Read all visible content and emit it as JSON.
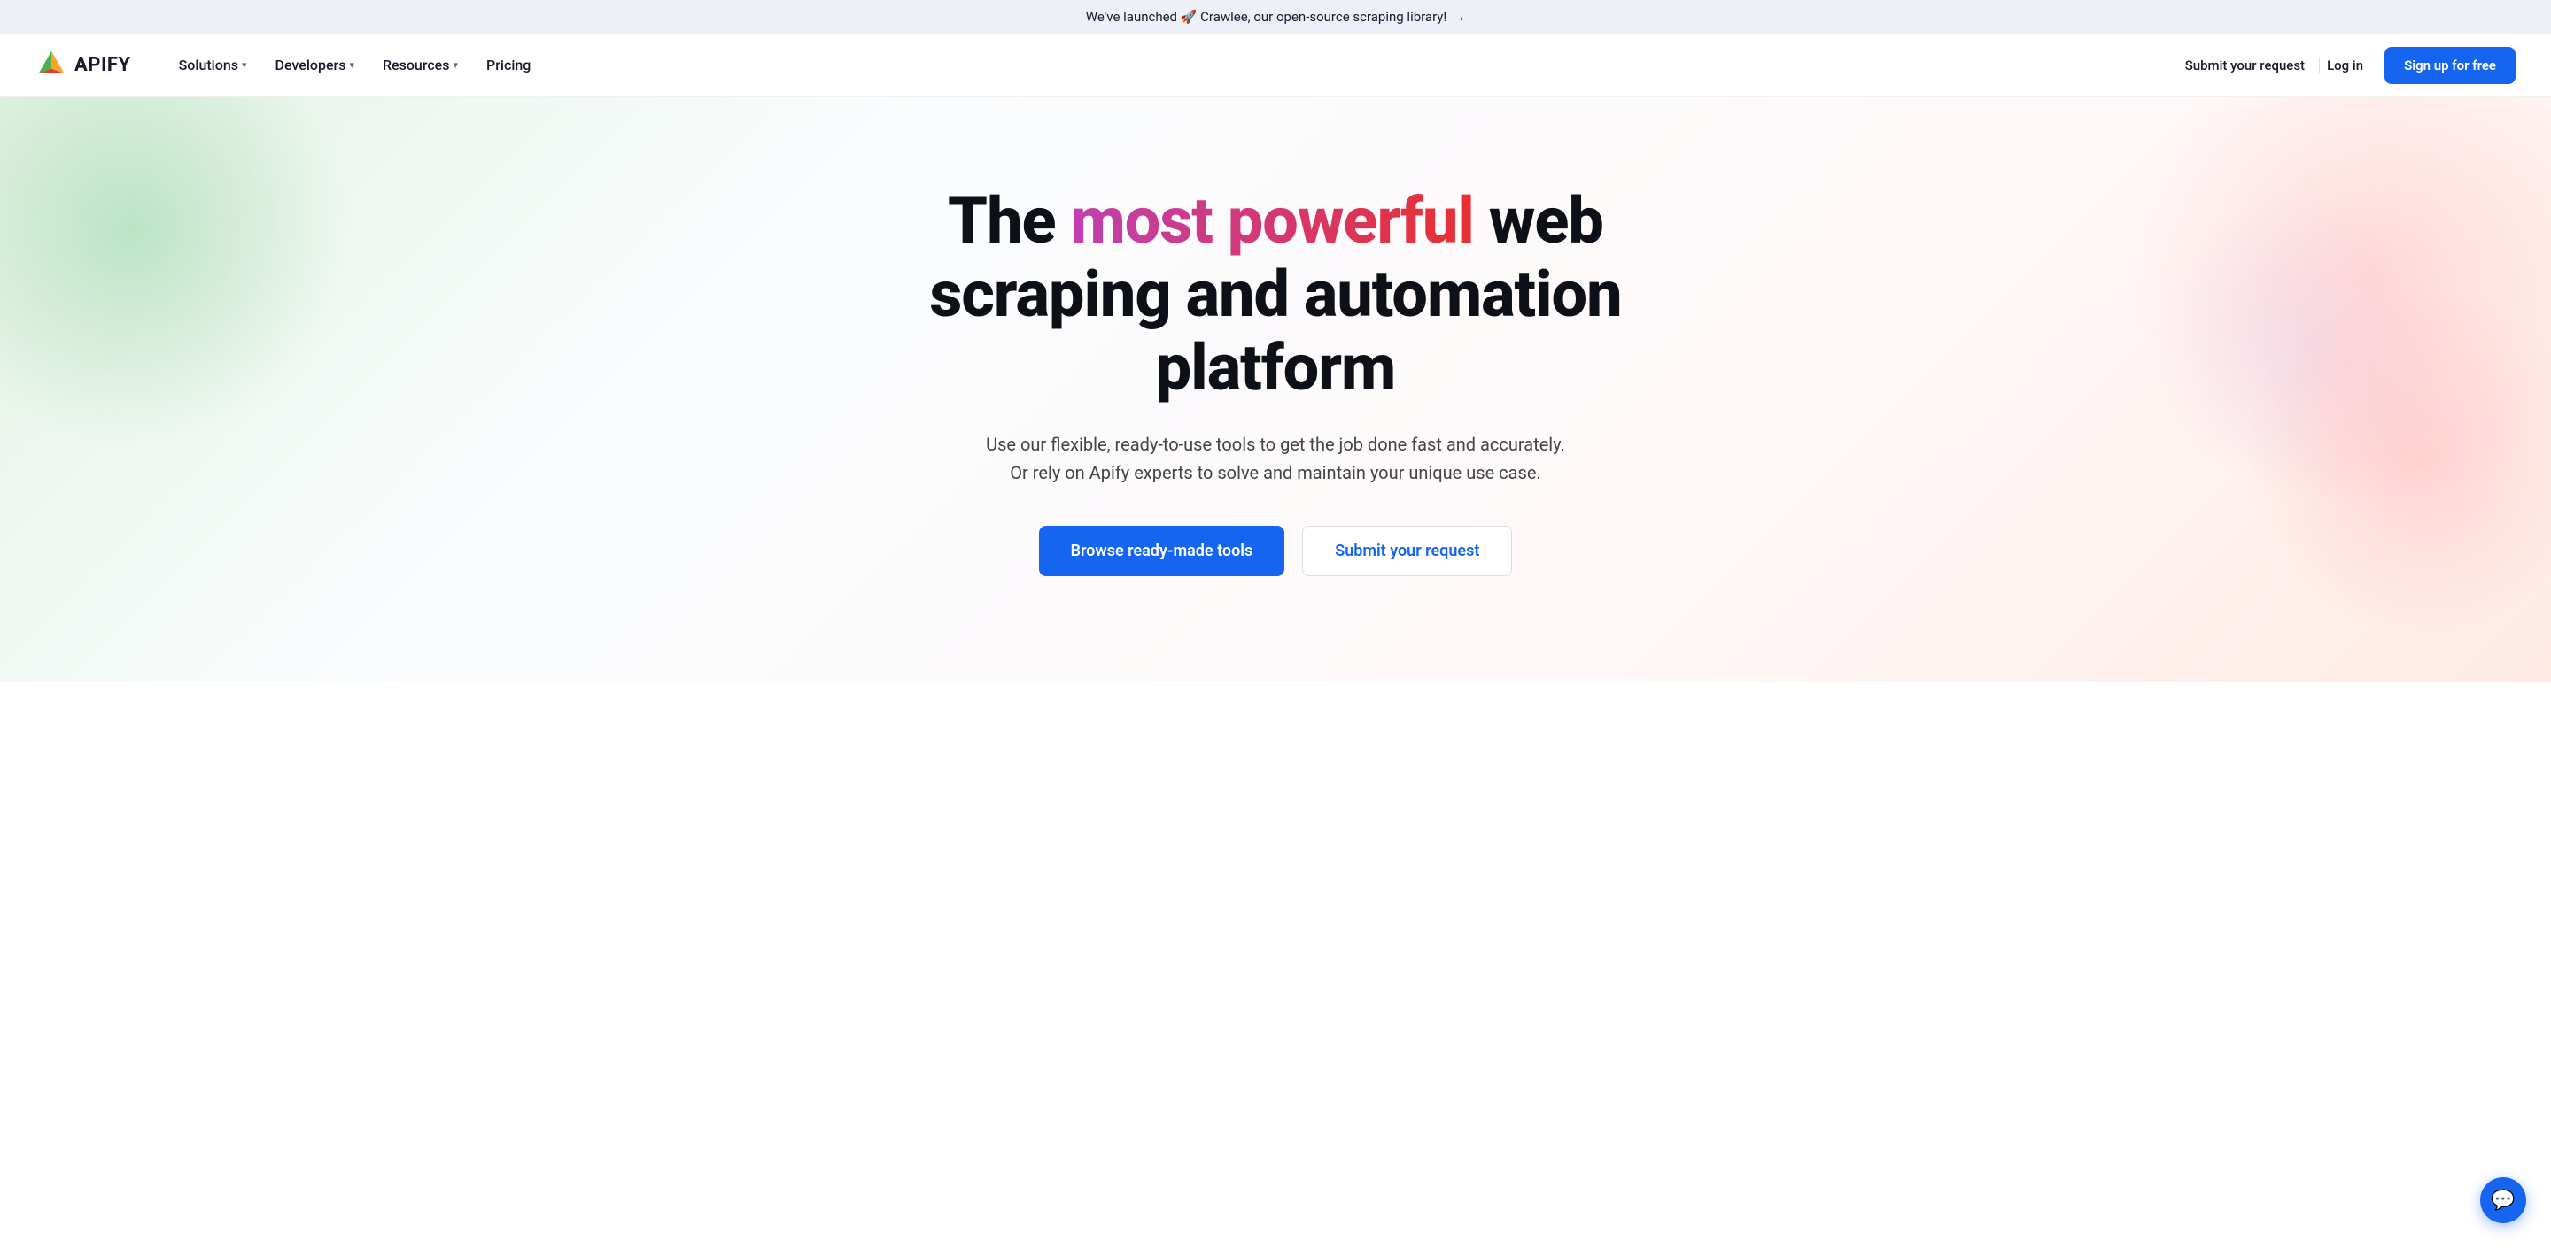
{
  "announcement": {
    "text": "We've launched 🚀 Crawlee, our open-source scraping library!",
    "arrow": "→"
  },
  "nav": {
    "logo_text": "APIFY",
    "links": [
      {
        "label": "Solutions",
        "has_dropdown": true
      },
      {
        "label": "Developers",
        "has_dropdown": true
      },
      {
        "label": "Resources",
        "has_dropdown": true
      },
      {
        "label": "Pricing",
        "has_dropdown": false
      }
    ],
    "submit_request_label": "Submit your request",
    "login_label": "Log in",
    "signup_label": "Sign up for free"
  },
  "hero": {
    "title_prefix": "The ",
    "title_gradient": "most powerful",
    "title_suffix": " web scraping and automation platform",
    "subtitle_line1": "Use our flexible, ready-to-use tools to get the job done fast and accurately.",
    "subtitle_line2": "Or rely on Apify experts to solve and maintain your unique use case.",
    "btn_primary_label": "Browse ready-made tools",
    "btn_secondary_label": "Submit your request"
  },
  "colors": {
    "brand_blue": "#1565f0",
    "gradient_start": "#c040b0",
    "gradient_end": "#e83030"
  }
}
